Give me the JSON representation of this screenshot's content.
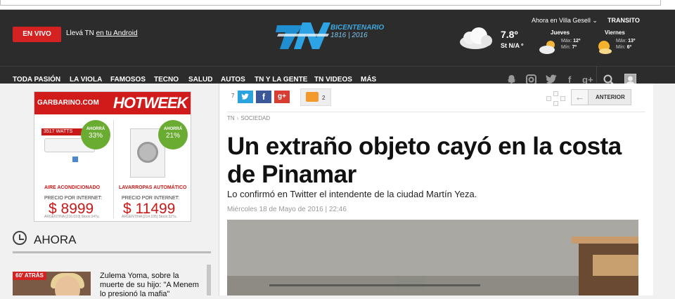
{
  "header": {
    "live_label": "EN VIVO",
    "android_prefix": "Llevá TN ",
    "android_link": "en tu Android",
    "logo_text": "TN",
    "bicentenario_title": "BICENTENARIO",
    "bicentenario_years": "1816 | 2016",
    "location": "Ahora en Villa Gesell ⌄",
    "transito": "TRANSITO"
  },
  "weather": {
    "temp": "7.8º",
    "st": "St N/A º",
    "days": [
      {
        "name": "Jueves",
        "max_label": "Máx:",
        "max": "12º",
        "min_label": "Mín:",
        "min": "7º",
        "icon": "partly-cloudy-icon"
      },
      {
        "name": "Viernes",
        "max_label": "Máx:",
        "max": "13º",
        "min_label": "Mín:",
        "min": "6º",
        "icon": "sun-cloud-icon"
      }
    ]
  },
  "nav": {
    "items": [
      "TODA PASIÓN",
      "LA VIOLA",
      "FAMOSOS",
      "TECNO",
      "SALUD",
      "AUTOS",
      "TN Y LA GENTE",
      "TN VIDEOS",
      "MÁS"
    ],
    "social": [
      "snapchat-icon",
      "instagram-icon",
      "twitter-icon",
      "facebook-icon",
      "google-plus-icon"
    ]
  },
  "ad": {
    "brand": "GARBARINO.COM",
    "hot": "HOTWEEK",
    "products": [
      {
        "badge_top": "AHORRÁ",
        "badge_pct": "33%",
        "title": "AIRE ACONDICIONADO",
        "precio": "PRECIO POR INTERNET:",
        "price": "$ 8999",
        "small": "ARGENTINA [216.019] Stock:347u.",
        "watts": "3517 WATTS"
      },
      {
        "badge_top": "AHORRÁ",
        "badge_pct": "21%",
        "title": "LAVARROPAS AUTOMÁTICO",
        "precio": "PRECIO POR INTERNET:",
        "price": "$ 11499",
        "small": "ARGENTINA [214.105] Stock:327u."
      }
    ]
  },
  "ahora": {
    "title": "AHORA",
    "tag": "60' ATRÁS",
    "news_text": "Zulema Yoma, sobre la muerte de su hijo: \"A Menem lo presionó la mafia\""
  },
  "article": {
    "share_count": "7",
    "comment_count": "2",
    "prev_label": "ANTERIOR",
    "crumb_home": "TN",
    "crumb_sep": "›",
    "crumb_section": "SOCIEDAD",
    "headline": "Un extraño objeto cayó en la costa de Pinamar",
    "subhead": "Lo confirmó en Twitter el intendente de la ciudad Martín Yeza.",
    "date": "Miércoles 18 de Mayo de 2016 | 22:46"
  },
  "colors": {
    "header_bg": "#2c2c2c",
    "live_red": "#d42121",
    "twitter": "#2aa3df",
    "facebook": "#3b5998",
    "google": "#d73d32",
    "badge_green": "#6aab32"
  }
}
